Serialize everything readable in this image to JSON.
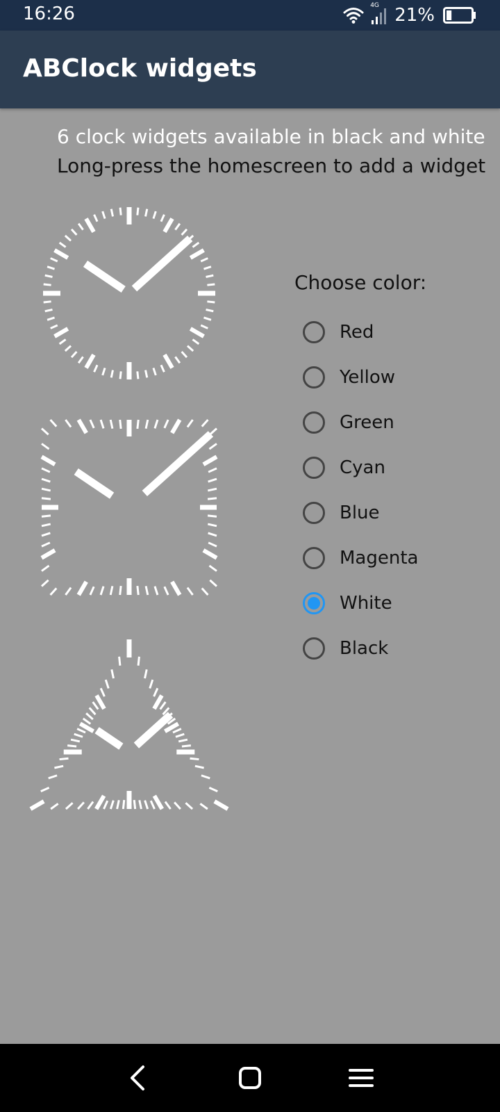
{
  "status_bar": {
    "time": "16:26",
    "network_label": "4G",
    "battery": "21%",
    "battery_level": 0.21
  },
  "app_bar": {
    "title": "ABClock widgets"
  },
  "info": {
    "line1": "6 clock widgets available in black and white",
    "line2": "Long-press the homescreen to add a widget"
  },
  "clocks": [
    {
      "name": "round",
      "hour": 10,
      "minute": 8
    },
    {
      "name": "square",
      "hour": 10,
      "minute": 8
    },
    {
      "name": "triangle",
      "hour": 10,
      "minute": 8
    }
  ],
  "color_picker": {
    "label": "Choose color:",
    "options": [
      "Red",
      "Yellow",
      "Green",
      "Cyan",
      "Blue",
      "Magenta",
      "White",
      "Black"
    ],
    "selected": "White"
  },
  "colors": {
    "status_bar": "#1c2f49",
    "app_bar": "#2d3e52",
    "background": "#9b9b9b",
    "accent": "#2196f3",
    "clock_face": "#ffffff"
  },
  "icons": {
    "wifi": "wifi-icon",
    "signal": "signal-icon",
    "battery": "battery-icon",
    "back": "back-icon",
    "home": "home-icon",
    "menu": "menu-icon"
  }
}
